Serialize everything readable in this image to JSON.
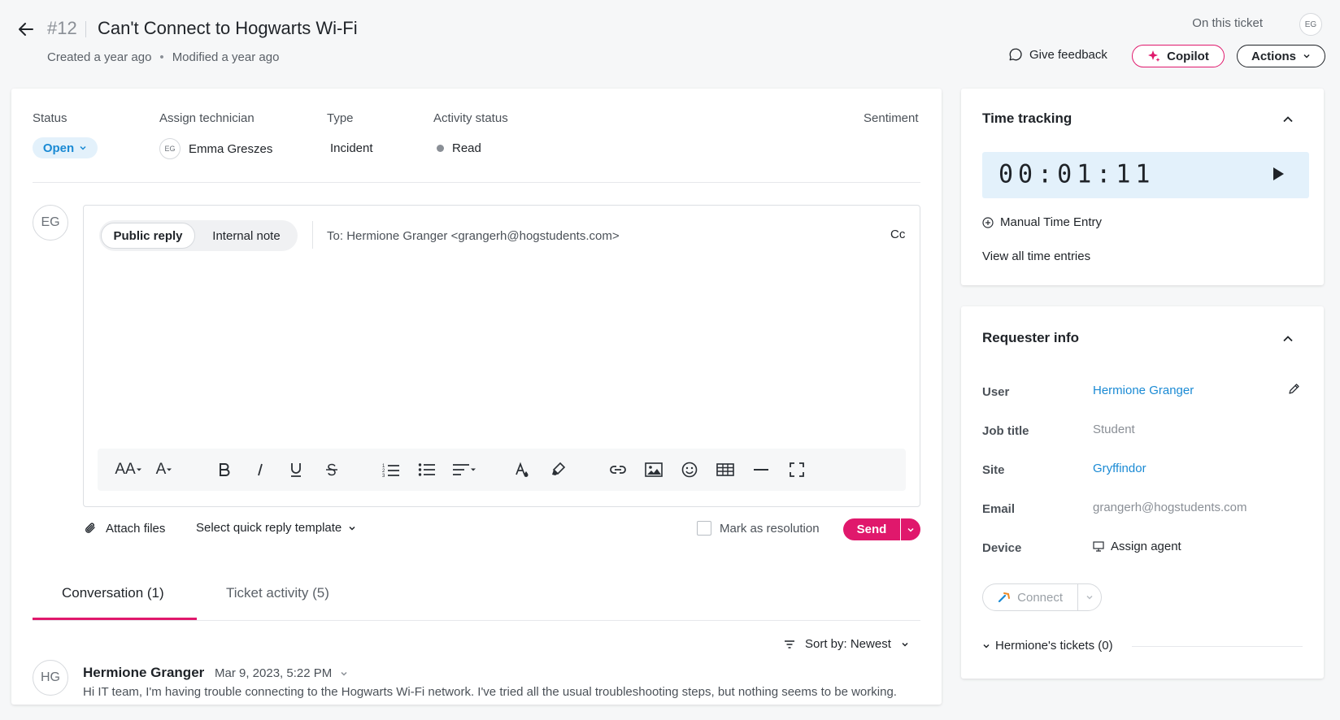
{
  "header": {
    "ticket_number": "#12",
    "title": "Can't Connect to Hogwarts Wi-Fi",
    "created": "Created a year ago",
    "modified": "Modified a year ago",
    "on_this_ticket": "On this ticket",
    "on_this_ticket_avatar": "EG",
    "give_feedback": "Give feedback",
    "copilot": "Copilot",
    "actions": "Actions"
  },
  "fields": {
    "status_label": "Status",
    "status_value": "Open",
    "technician_label": "Assign technician",
    "technician_avatar": "EG",
    "technician_value": "Emma Greszes",
    "type_label": "Type",
    "type_value": "Incident",
    "activity_label": "Activity status",
    "activity_value": "Read",
    "sentiment_label": "Sentiment"
  },
  "composer": {
    "avatar": "EG",
    "public_reply": "Public reply",
    "internal_note": "Internal note",
    "to_label": "To:",
    "to_value": "Hermione Granger <grangerh@hogstudents.com>",
    "cc": "Cc",
    "attach_files": "Attach files",
    "quick_reply": "Select quick reply template",
    "mark_resolution": "Mark as resolution",
    "send": "Send",
    "toolbar_font_size": "AA",
    "toolbar_font_color": "A"
  },
  "tabs": {
    "conversation": "Conversation (1)",
    "activity": "Ticket activity (5)"
  },
  "sort": {
    "label": "Sort by: Newest"
  },
  "message": {
    "avatar": "HG",
    "author": "Hermione Granger",
    "date": "Mar 9, 2023, 5:22 PM",
    "body": "Hi IT team, I'm having trouble connecting to the Hogwarts Wi-Fi network. I've tried all the usual troubleshooting steps, but nothing seems to be working."
  },
  "time_tracking": {
    "title": "Time tracking",
    "timer": "00:01:11",
    "manual_entry": "Manual Time Entry",
    "view_all": "View all time entries"
  },
  "requester": {
    "title": "Requester info",
    "user_label": "User",
    "user_value": "Hermione Granger",
    "job_label": "Job title",
    "job_value": "Student",
    "site_label": "Site",
    "site_value": "Gryffindor",
    "email_label": "Email",
    "email_value": "grangerh@hogstudents.com",
    "device_label": "Device",
    "device_value": "Assign agent",
    "connect": "Connect",
    "tickets": "Hermione's tickets (0)"
  },
  "colors": {
    "accent": "#e0186c",
    "link": "#1a8ad4",
    "status_bg": "#e3f1fb"
  },
  "icons": [
    "back-arrow-icon",
    "chat-bubble-icon",
    "sparkle-icon",
    "chevron-down-icon",
    "bold-icon",
    "italic-icon",
    "underline-icon",
    "strikethrough-icon",
    "ordered-list-icon",
    "bullet-list-icon",
    "align-icon",
    "text-color-icon",
    "highlighter-icon",
    "link-icon",
    "image-icon",
    "emoji-icon",
    "table-icon",
    "horizontal-rule-icon",
    "fullscreen-icon",
    "paperclip-icon",
    "filter-icon",
    "chevron-up-icon",
    "play-icon",
    "plus-circle-icon",
    "pencil-icon",
    "monitor-icon",
    "connect-icon"
  ]
}
